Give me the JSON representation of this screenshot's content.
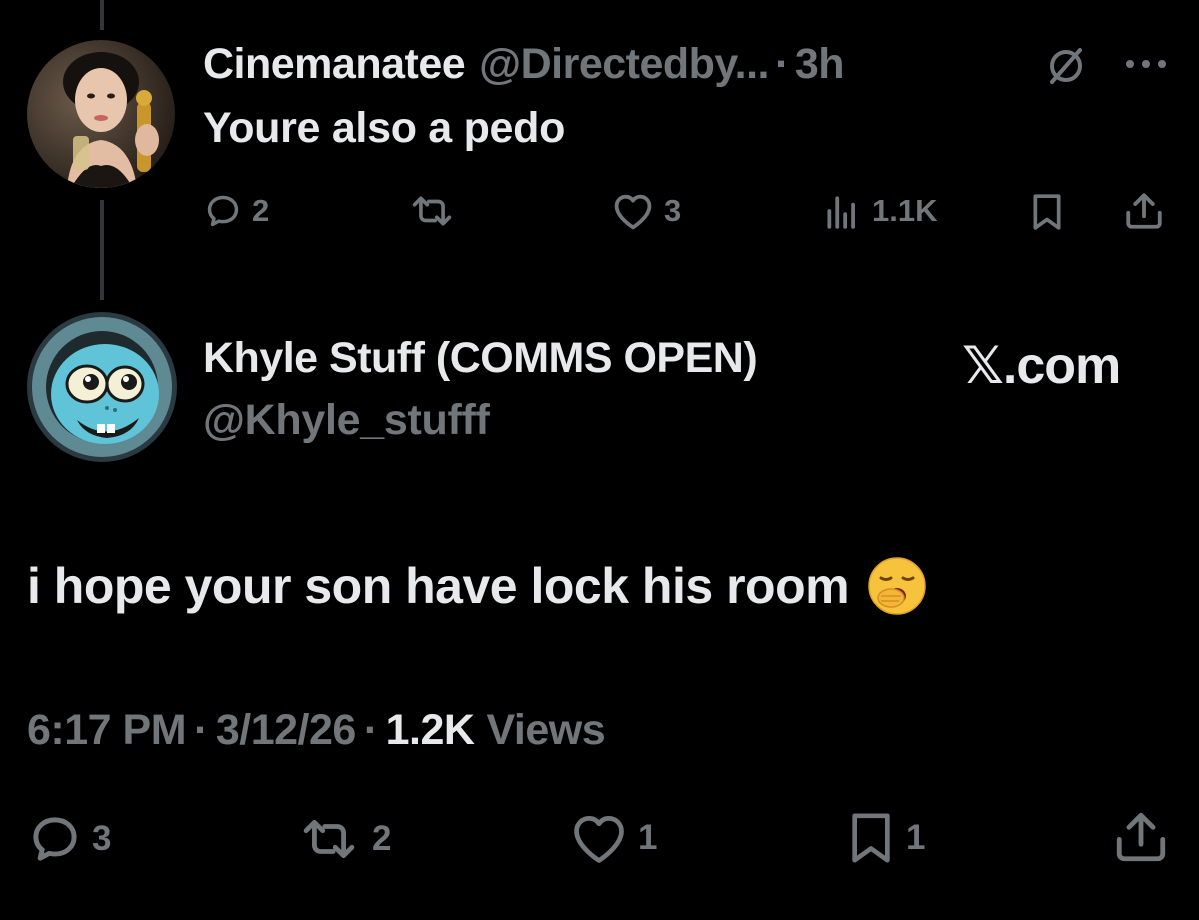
{
  "parent_tweet": {
    "display_name": "Cinemanatee",
    "handle": "@Directedby...",
    "separator": "·",
    "time": "3h",
    "text": "Youre also a pedo",
    "replies": "2",
    "likes": "3",
    "views": "1.1K"
  },
  "main_tweet": {
    "display_name": "Khyle Stuff (COMMS OPEN)",
    "handle": "@Khyle_stufff",
    "watermark": "𝕏.com",
    "text": "i hope your son have lock his room",
    "emoji": "yawning-face-emoji",
    "time": "6:17 PM",
    "date": "3/12/26",
    "separator": "·",
    "views_count": "1.2K",
    "views_label": "Views",
    "replies": "3",
    "reposts": "2",
    "likes": "1",
    "bookmarks": "1"
  },
  "colors": {
    "background": "#000000",
    "primary_text": "#e7e9ea",
    "secondary_text": "#71767b",
    "thread_line": "#333639"
  }
}
